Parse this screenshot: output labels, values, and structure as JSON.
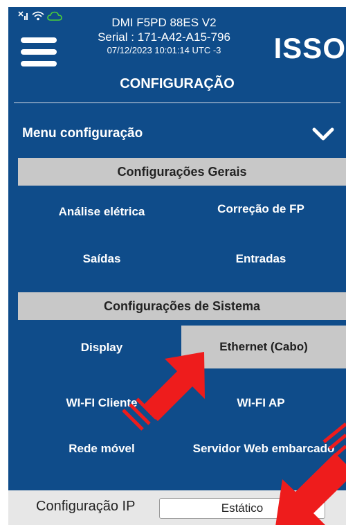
{
  "header": {
    "device_model": "DMI F5PD 88ES V2",
    "serial": "Serial : 171-A42-A15-796",
    "datetime": "07/12/2023 10:01:14 UTC -3",
    "brand": "ISSO",
    "page_title": "CONFIGURAÇÃO"
  },
  "menu": {
    "label": "Menu configuração"
  },
  "sections": {
    "general": {
      "title": "Configurações Gerais",
      "items": [
        "Análise elétrica",
        "Correção de FP",
        "Saídas",
        "Entradas"
      ]
    },
    "system": {
      "title": "Configurações de Sistema",
      "items": [
        "Display",
        "Ethernet (Cabo)",
        "WI-FI Cliente",
        "WI-FI AP",
        "Rede móvel",
        "Servidor Web embarcado"
      ],
      "active": "Ethernet (Cabo)"
    }
  },
  "ip_config": {
    "label": "Configuração IP",
    "selected": "Estático"
  },
  "colors": {
    "panel": "#0f4c8a",
    "section_bar": "#c8c8c8",
    "arrow": "#ee1c1c"
  }
}
